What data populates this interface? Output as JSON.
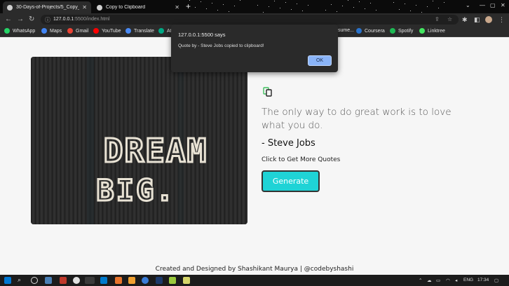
{
  "browser": {
    "tabs": [
      {
        "title": "30-Days-of-Projects/5_Copy_To..."
      },
      {
        "title": "Copy to Clipboard"
      }
    ],
    "address": {
      "host": "127.0.0.1",
      "path": ":5500/index.html"
    },
    "bookmarks": [
      {
        "label": "WhatsApp",
        "color": "#25d366"
      },
      {
        "label": "Maps",
        "color": "#4285f4"
      },
      {
        "label": "Gmail",
        "color": "#ea4335"
      },
      {
        "label": "YouTube",
        "color": "#ff0000"
      },
      {
        "label": "Translate",
        "color": "#4a8af4"
      },
      {
        "label": "At",
        "color": "#00a884"
      },
      {
        "label": "sume...",
        "color": "#777777"
      },
      {
        "label": "Coursera",
        "color": "#2a73cc"
      },
      {
        "label": "Spotify",
        "color": "#1db954"
      },
      {
        "label": "Linktree",
        "color": "#43e660"
      }
    ]
  },
  "page": {
    "image_text": "DREAM BIG.",
    "quote": "The only way to do great work is to love what you do.",
    "author": "- Steve Jobs",
    "more_label": "Click to Get More Quotes",
    "generate_label": "Generate",
    "footer": "Created and Designed by Shashikant Maurya | @codebyshashi"
  },
  "alert": {
    "origin": "127.0.0.1:5500 says",
    "message": "Quote by - Steve Jobs copied to clipboard!",
    "ok_label": "OK"
  },
  "taskbar": {
    "language": "ENG",
    "time": "17:34"
  },
  "colors": {
    "accent_button": "#1fd3d6",
    "copy_icon": "#3fbf5f",
    "dialog_ok": "#8ab4f8"
  }
}
